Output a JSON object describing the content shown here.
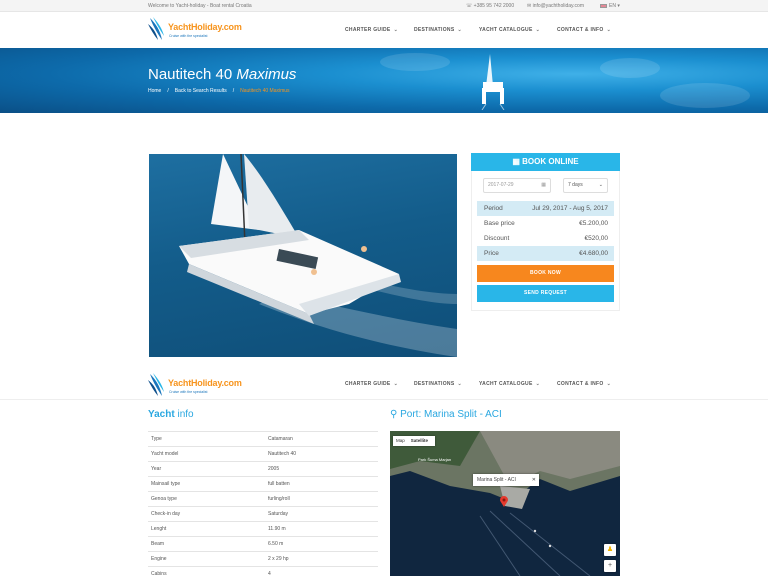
{
  "topbar": {
    "welcome": "Welcome to Yacht-holiday - Boat rental Croatia",
    "phone": "+385 95 742 2000",
    "email": "info@yachtholiday.com",
    "lang": "EN"
  },
  "brand": {
    "name": "YachtHoliday.com",
    "tagline": "Cruise with the specialist"
  },
  "nav": [
    {
      "label": "CHARTER GUIDE"
    },
    {
      "label": "DESTINATIONS"
    },
    {
      "label": "YACHT CATALOGUE"
    },
    {
      "label": "CONTACT & INFO"
    }
  ],
  "hero": {
    "title_main": "Nautitech 40",
    "title_italic": "Maximus",
    "breadcrumbs": [
      "Home",
      "Back to Search Results",
      "Nautitech 40 Maximus"
    ]
  },
  "booking": {
    "heading": "BOOK ONLINE",
    "date_value": "2017-07-29",
    "duration_value": "7 days",
    "rows": [
      {
        "label": "Period",
        "value": "Jul 29, 2017 - Aug 5, 2017"
      },
      {
        "label": "Base price",
        "value": "€5.200,00"
      },
      {
        "label": "Discount",
        "value": "€520,00"
      },
      {
        "label": "Price",
        "value": "€4.680,00"
      }
    ],
    "book_now": "BOOK NOW",
    "send_request": "SEND REQUEST"
  },
  "yacht_info": {
    "title_bold": "Yacht",
    "title_rest": "info",
    "rows": [
      {
        "k": "Type",
        "v": "Catamaran"
      },
      {
        "k": "Yacht model",
        "v": "Nautitech 40"
      },
      {
        "k": "Year",
        "v": "2005"
      },
      {
        "k": "Mainsail type",
        "v": "full batten"
      },
      {
        "k": "Genoa type",
        "v": "furling/roll"
      },
      {
        "k": "Check-in day",
        "v": "Saturday"
      },
      {
        "k": "Lenght",
        "v": "11.90 m"
      },
      {
        "k": "Beam",
        "v": "6.50 m"
      },
      {
        "k": "Engine",
        "v": "2 x 29 hp"
      },
      {
        "k": "Cabins",
        "v": "4"
      }
    ]
  },
  "port": {
    "title": "Port: Marina Split - ACI",
    "map_btn": "Map",
    "sat_btn": "Satellite",
    "tooltip": "Marina Split - ACI",
    "map_label": "Park Šuma Marjan"
  },
  "colors": {
    "accent": "#29b6e8",
    "orange": "#f7871e",
    "highlight": "#d4ebf5"
  }
}
